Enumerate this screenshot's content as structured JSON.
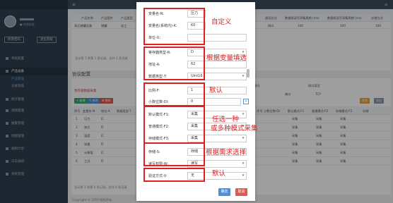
{
  "topbar": {
    "menu_icon": "≡",
    "home_icon": "⌂"
  },
  "sidebar": {
    "profile_status": "● 在线状态",
    "btn_left": "修改密码",
    "btn_right": "退出系统",
    "items": [
      {
        "label": "系统配置",
        "active": false
      },
      {
        "label": "产品设备",
        "active": true
      },
      {
        "label": "统计管理",
        "active": false
      },
      {
        "label": "视频管理",
        "active": false
      },
      {
        "label": "报警管理",
        "active": false
      },
      {
        "label": "地图管理",
        "active": false
      },
      {
        "label": "规则计划",
        "active": false
      },
      {
        "label": "日志通知",
        "active": false
      },
      {
        "label": "系统管理",
        "active": false
      }
    ],
    "subitems": [
      {
        "label": "产品管理",
        "active": true
      },
      {
        "label": "设备管理",
        "active": false
      }
    ]
  },
  "main": {
    "top_table": {
      "headers": [
        "产品名称",
        "产品图片",
        "产品类型",
        "通讯方式",
        "数据帧读写采集周期 (ms)",
        "数据帧读写采集周期 (ms)",
        "存储方式"
      ],
      "row": [
        "高压储罐设备",
        "储罐",
        "化工",
        "网口",
        "100",
        "100",
        "100"
      ],
      "pagination": "显示第 1 到第 1 条记录，总共 1 条记录"
    },
    "section_title": "协议配置",
    "sub_title": "寄存器数据采集",
    "toolbar": {
      "add": "+ 新增",
      "edit": "✎ 修改",
      "delete": "✖ 删除",
      "search": "搜索",
      "export": "导出"
    },
    "bottom_table": {
      "headers": [
        "序号",
        "变量名-N",
        "地址-A",
        "数据类型-T",
        "序号",
        "读写权限-W",
        "小数位数-DI",
        "默认模式-F1",
        "普通模式-F2",
        "存储模式-F3",
        "存储"
      ],
      "col_headers_mid": [
        "变量名称",
        "寄存器号",
        "接口类型",
        "端口",
        "TCP"
      ],
      "rows": [
        [
          "1",
          "压力",
          "D"
        ],
        [
          "2",
          "液位",
          "D"
        ],
        [
          "3",
          "温度",
          "D"
        ],
        [
          "4",
          "流量",
          "D"
        ],
        [
          "5",
          "计算值",
          "D"
        ],
        [
          "6",
          "工况",
          "D"
        ]
      ],
      "cell_values": [
        "采集",
        "采集",
        "采集"
      ],
      "pagination": "显示第 1 到第 6 条记录，总共 6 条记录"
    },
    "footer": "Copyright © 2019 版权所有"
  },
  "modal": {
    "fields": [
      {
        "label": "变量名-N:",
        "value": "压力"
      },
      {
        "label": "变量名(系统内)-K:",
        "value": "K0"
      },
      {
        "label": "单位-U:",
        "value": ""
      },
      {
        "label": "寄存器类型-R:",
        "value": "D"
      },
      {
        "label": "地址-A:",
        "value": "62"
      },
      {
        "label": "数据类型-T:",
        "value": "Uint16"
      },
      {
        "label": "比例-F:",
        "value": "1"
      },
      {
        "label": "小数位数-DI:",
        "value": "0"
      },
      {
        "label": "默认模式-F1:",
        "value": "采集"
      },
      {
        "label": "普通模式-F2:",
        "value": "采集"
      },
      {
        "label": "存储模式-F3:",
        "value": "采集"
      },
      {
        "label": "存储-S:",
        "value": "存储"
      },
      {
        "label": "读写权限-W:",
        "value": "读写"
      },
      {
        "label": "验证方式-V:",
        "value": "无"
      }
    ],
    "ok_label": "确定",
    "cancel_label": "取消"
  },
  "annotations": [
    "自定义",
    "根据变量填选",
    "默认",
    "任选一种",
    "或多种模式采集",
    "根据需求选择",
    "默认"
  ],
  "colors": {
    "annotation": "#e02020",
    "sidebar": "#2f3f50",
    "primary": "#4a90d9",
    "danger": "#e05a4e"
  }
}
